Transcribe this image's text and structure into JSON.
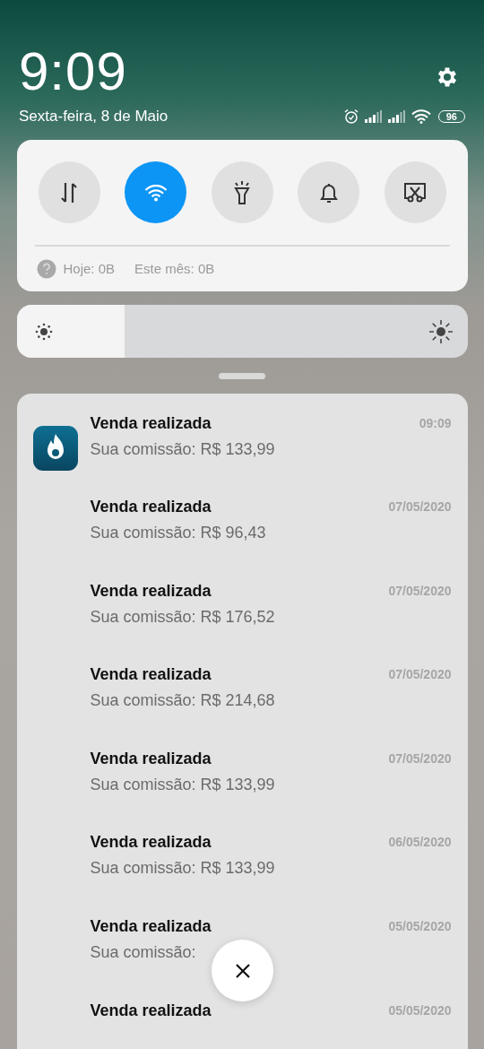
{
  "status": {
    "time": "9:09",
    "date": "Sexta-feira, 8 de Maio",
    "battery": "96"
  },
  "toggles": [
    {
      "kind": "data",
      "on": false
    },
    {
      "kind": "wifi",
      "on": true
    },
    {
      "kind": "flashlight",
      "on": false
    },
    {
      "kind": "bell",
      "on": false
    },
    {
      "kind": "screenshot",
      "on": false
    }
  ],
  "usage": {
    "today": "Hoje: 0B",
    "month": "Este mês: 0B"
  },
  "brightness": {
    "level": 0.24
  },
  "notifications": [
    {
      "title": "Venda realizada",
      "body": "Sua comissão: R$ 133,99",
      "time": "09:09",
      "show_icon": true
    },
    {
      "title": "Venda realizada",
      "body": "Sua comissão: R$ 96,43",
      "time": "07/05/2020",
      "show_icon": false
    },
    {
      "title": "Venda realizada",
      "body": "Sua comissão: R$ 176,52",
      "time": "07/05/2020",
      "show_icon": false
    },
    {
      "title": "Venda realizada",
      "body": "Sua comissão: R$ 214,68",
      "time": "07/05/2020",
      "show_icon": false
    },
    {
      "title": "Venda realizada",
      "body": "Sua comissão: R$ 133,99",
      "time": "07/05/2020",
      "show_icon": false
    },
    {
      "title": "Venda realizada",
      "body": "Sua comissão: R$ 133,99",
      "time": "06/05/2020",
      "show_icon": false
    },
    {
      "title": "Venda realizada",
      "body": "Sua comissão:",
      "time": "05/05/2020",
      "show_icon": false
    },
    {
      "title": "Venda realizada",
      "time": "05/05/2020",
      "show_icon": false
    }
  ]
}
